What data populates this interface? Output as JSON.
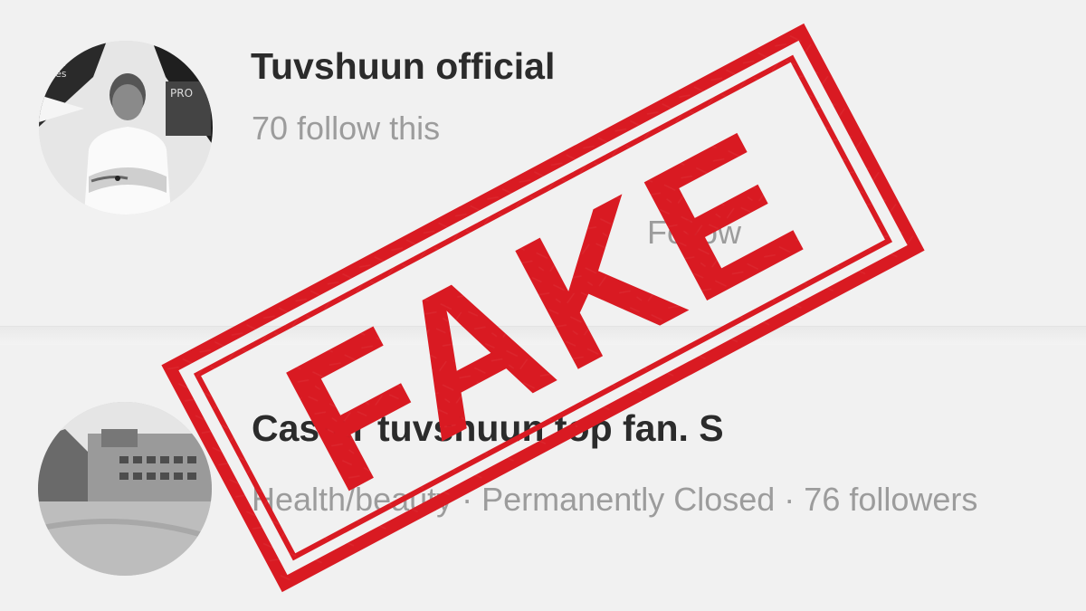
{
  "listing": [
    {
      "name": "Tuvshuun official",
      "meta": "70 follow this",
      "action": "Follow",
      "avatar_icon": "person-photo-avatar"
    },
    {
      "name": "Caster tuvshuun top fan. S",
      "meta": "Health/beauty · Permanently Closed · 76 followers",
      "avatar_icon": "building-photo-avatar"
    }
  ],
  "stamp": {
    "label": "FAKE",
    "color": "#d91a22"
  },
  "avatar_badge_text": {
    "top": "nt\nes",
    "side": "PRO"
  }
}
